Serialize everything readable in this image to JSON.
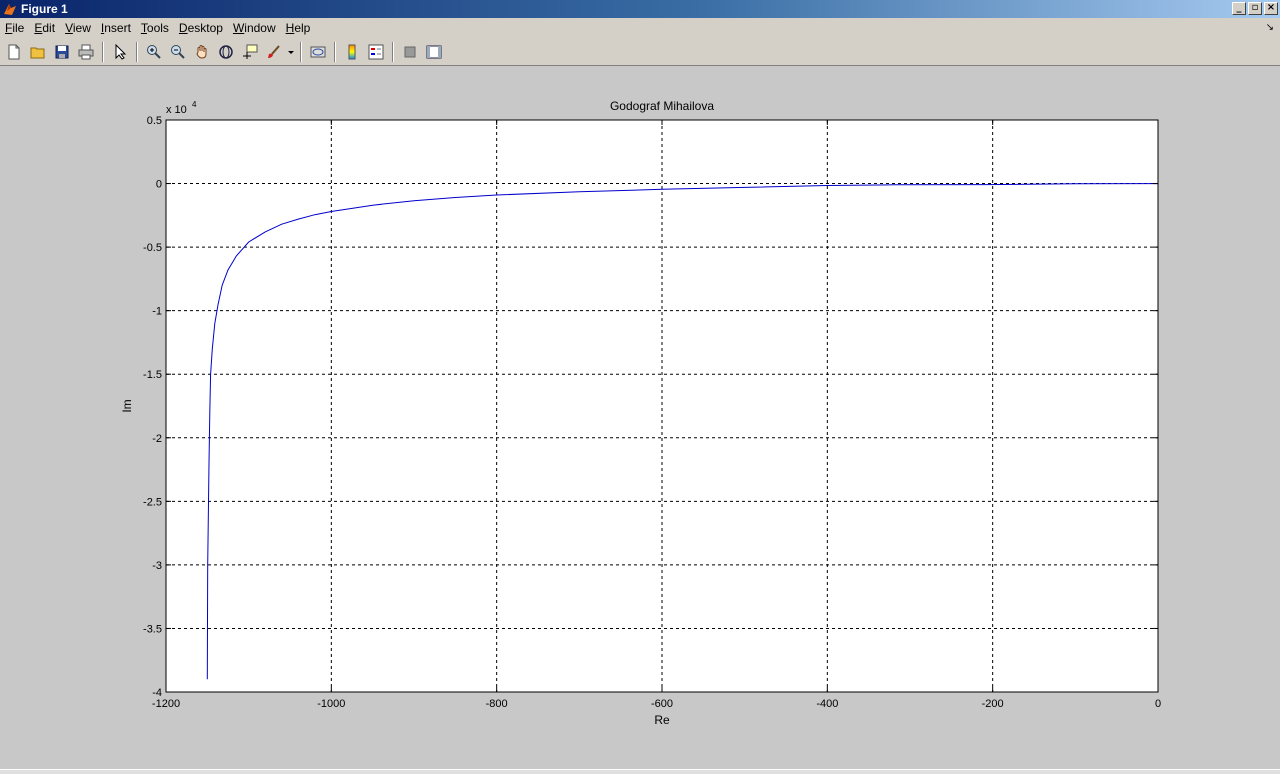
{
  "window": {
    "title": "Figure 1",
    "controls": [
      "_",
      "▫",
      "×"
    ]
  },
  "menu": [
    {
      "label": "File",
      "u": "F",
      "rest": "ile"
    },
    {
      "label": "Edit",
      "u": "E",
      "rest": "dit"
    },
    {
      "label": "View",
      "u": "V",
      "rest": "iew"
    },
    {
      "label": "Insert",
      "u": "I",
      "rest": "nsert"
    },
    {
      "label": "Tools",
      "u": "T",
      "rest": "ools"
    },
    {
      "label": "Desktop",
      "u": "D",
      "rest": "esktop"
    },
    {
      "label": "Window",
      "u": "W",
      "rest": "indow"
    },
    {
      "label": "Help",
      "u": "H",
      "rest": "elp"
    }
  ],
  "toolbar_icons": [
    "new-figure-icon",
    "open-file-icon",
    "save-icon",
    "print-icon",
    "select-arrow-icon",
    "zoom-in-icon",
    "zoom-out-icon",
    "pan-hand-icon",
    "rotate-3d-icon",
    "data-cursor-icon",
    "brush-icon",
    "link-plot-icon",
    "colorbar-icon",
    "legend-icon",
    "hide-plot-tools-icon",
    "show-plot-tools-icon"
  ],
  "chart_data": {
    "type": "line",
    "title": "Godograf Mihailova",
    "xlabel": "Re",
    "ylabel": "Im",
    "y_multiplier_label": "x 10",
    "y_multiplier_exp": "4",
    "xlim": [
      -1200,
      0
    ],
    "ylim": [
      -4,
      0.5
    ],
    "x_ticks": [
      -1200,
      -1000,
      -800,
      -600,
      -400,
      -200,
      0
    ],
    "x_tick_labels": [
      "-1200",
      "-1000",
      "-800",
      "-600",
      "-400",
      "-200",
      "0"
    ],
    "y_ticks": [
      0.5,
      0,
      -0.5,
      -1,
      -1.5,
      -2,
      -2.5,
      -3,
      -3.5,
      -4
    ],
    "y_tick_labels": [
      "0.5",
      "0",
      "-0.5",
      "-1",
      "-1.5",
      "-2",
      "-2.5",
      "-3",
      "-3.5",
      "-4"
    ],
    "grid": true,
    "line_color": "#0000cc",
    "series": [
      {
        "x": [
          -1150,
          -1149.5,
          -1148,
          -1147,
          -1146,
          -1144,
          -1141,
          -1137,
          -1132,
          -1125,
          -1115,
          -1100,
          -1080,
          -1060,
          -1040,
          -1020,
          -1000,
          -950,
          -900,
          -850,
          -800,
          -700,
          -600,
          -500,
          -400,
          -320,
          -210,
          -100,
          0
        ],
        "y": [
          -3.9,
          -3.0,
          -2.2,
          -1.8,
          -1.5,
          -1.3,
          -1.1,
          -0.95,
          -0.8,
          -0.68,
          -0.57,
          -0.46,
          -0.38,
          -0.32,
          -0.28,
          -0.245,
          -0.22,
          -0.17,
          -0.135,
          -0.11,
          -0.09,
          -0.065,
          -0.045,
          -0.03,
          -0.015,
          -0.01,
          -0.008,
          -0.002,
          0
        ]
      }
    ]
  }
}
